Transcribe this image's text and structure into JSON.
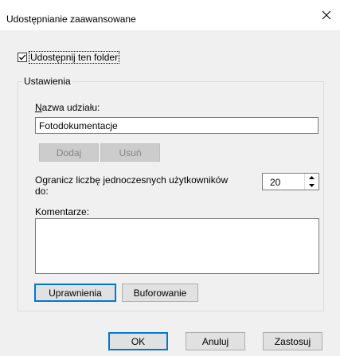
{
  "window": {
    "title": "Udostępnianie zaawansowane",
    "close_icon": "close-icon"
  },
  "share_folder": {
    "label": "Udostępnij ten folder",
    "checked": true
  },
  "settings": {
    "legend": "Ustawienia",
    "share_name_label": "Nazwa udziału:",
    "share_name_value": "Fotodokumentacje",
    "add_button": "Dodaj",
    "remove_button": "Usuń",
    "limit_users_label_line1": "Ogranicz liczbę jednoczesnych użytkowników",
    "limit_users_label_line2": "do:",
    "limit_users_value": "20",
    "comments_label": "Komentarze:",
    "comments_value": ""
  },
  "actions": {
    "permissions_button": "Uprawnienia",
    "caching_button": "Buforowanie"
  },
  "footer": {
    "ok_button": "OK",
    "cancel_button": "Anuluj",
    "apply_button": "Zastosuj"
  },
  "colors": {
    "dialog_bg": "#f0f0f0",
    "focus_border": "#0078d7",
    "disabled_text": "#838383"
  }
}
